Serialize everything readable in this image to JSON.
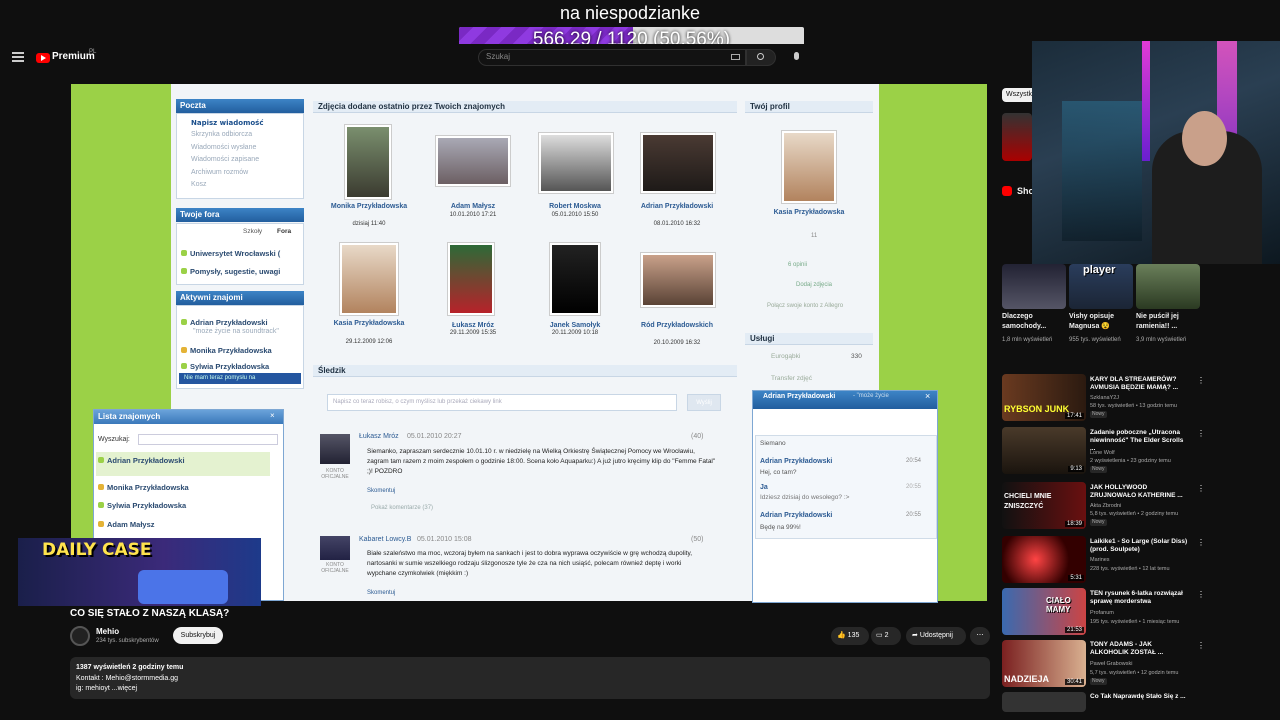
{
  "overlay": {
    "title": "na niespodzianke",
    "goal_text": "566.29 / 1120 (50.56%)",
    "goal_fraction": 0.5056,
    "fill_color": "#7a29c4"
  },
  "header": {
    "brand": "Premium",
    "brand_region": "PL",
    "search_placeholder": "Szukaj"
  },
  "video": {
    "poczta": {
      "title": "Poczta",
      "items": [
        "Napisz wiadomość",
        "Skrzynka odbiorcza",
        "Wiadomości wysłane",
        "Wiadomości zapisane",
        "Archiwum rozmów",
        "Kosz"
      ]
    },
    "fora": {
      "title": "Twoje fora",
      "tab_a": "Szkoły",
      "tab_b": "Fora",
      "items": [
        "Uniwersytet Wrocławski (",
        "Pomysły, sugestie, uwagi"
      ]
    },
    "aktywni": {
      "title": "Aktywni znajomi",
      "items": [
        "Adrian Przykładowski",
        "Monika Przykładowska",
        "Sylwia Przykładowska"
      ],
      "sub": "\"może życie na soundtrack\"",
      "status": "Nie mam teraz pomysłu na"
    },
    "lista": {
      "title": "Lista znajomych",
      "search_label": "Wyszukaj:",
      "items": [
        "Adrian Przykładowski",
        "Monika Przykładowska",
        "Sylwia Przykładowska",
        "Adam Małysz"
      ]
    },
    "zdjecia": {
      "title": "Zdjęcia dodane ostatnio przez Twoich znajomych",
      "photos": [
        {
          "name": "Monika Przykładowska",
          "date": "dzisiaj 11:40"
        },
        {
          "name": "Adam Małysz",
          "date": "10.01.2010 17:21"
        },
        {
          "name": "Robert Moskwa",
          "date": "05.01.2010 15:50"
        },
        {
          "name": "Adrian Przykładowski",
          "date": "08.01.2010 16:32"
        },
        {
          "name": "Kasia Przykładowska",
          "date": "29.12.2009 12:06"
        },
        {
          "name": "Łukasz Mróz",
          "date": "29.11.2009 15:35"
        },
        {
          "name": "Janek Samołyk",
          "date": "20.11.2009 10:18"
        },
        {
          "name": "Ród Przykładowskich",
          "date": "20.10.2009 16:32"
        }
      ]
    },
    "sledzik": {
      "title": "Śledzik",
      "input_placeholder": "Napisz co teraz robisz, o czym myślisz lub przekaż ciekawy link",
      "button": "Wyślij",
      "posts": [
        {
          "author": "Łukasz Mróz",
          "date": "05.01.2010 20:27",
          "count": "(40)",
          "text": "Siemanko, zapraszam serdecznie 10.01.10 r. w niedzielę na Wielką Orkiestrę Świątecznej Pomocy we Wrocławiu, zagram tam razem z moim zespołem o godzinie 18:00. Scena koło Aquaparku:) A już jutro kręcimy klip do \"Femme Fatal\" ;)! POZDRO",
          "comment": "Skomentuj",
          "show": "Pokaż komentarze (37)",
          "tag": "KONTO OFICJALNE"
        },
        {
          "author": "Kabaret Lowcy.B",
          "date": "05.01.2010 15:08",
          "count": "(50)",
          "text": "Białe szaleństwo ma moc, wczoraj byłem na sankach i jest to dobra wyprawa oczywiście w grę wchodzą dupolity, nartosanki w sumie wszelkiego rodzaju ślizgonosze tyle że cza na nich usiąść, polecam również deptę i worki wypchane czymkolwiek (miękkim :)",
          "comment": "Skomentuj",
          "tag": "KONTO OFICJALNE"
        }
      ]
    },
    "profil": {
      "title": "Twój profil",
      "name": "Kasia Przykładowska",
      "ops": "6 opinii",
      "add_photo": "Dodaj zdjęcia",
      "allegro": "Połącz swoje konto z Allegro",
      "count": "11"
    },
    "uslugi": {
      "title": "Usługi",
      "items": [
        {
          "label": "Eurogąbki",
          "value": "330"
        },
        {
          "label": "Transfer zdjęć",
          "value": ""
        }
      ]
    },
    "chat": {
      "title": "Adrian Przykładowski",
      "subtitle": "- \"może życie",
      "messages": [
        {
          "who": "Siemano",
          "time": ""
        },
        {
          "who": "Adrian Przykładowski",
          "time": "20:54",
          "text": "Hej, co tam?"
        },
        {
          "who": "Ja",
          "time": "20:55",
          "text": "Idziesz dzisiaj do wesołego? :>"
        },
        {
          "who": "Adrian Przykładowski",
          "time": "20:55",
          "text": "Będę na 99%!"
        }
      ]
    },
    "daily_case": "DAILY CASE"
  },
  "meta": {
    "title": "CO SIĘ STAŁO Z NASZĄ KLASĄ?",
    "channel": "Mehio",
    "subs": "234 tys. subskrybentów",
    "subscribe": "Subskrybuj",
    "likes": "135",
    "comments": "2",
    "share": "Udostępnij",
    "desc_line1": "1387 wyświetleń  2 godziny temu",
    "desc_line2": "Kontakt : Mehio@stormmedia.gg",
    "desc_line3": "ig: mehioyt  ...więcej"
  },
  "sidebar": {
    "chip": "Wszystkie",
    "shorts_label": "Shorts",
    "shorts": [
      {
        "title": "Dlaczego samochody...",
        "views": "1,8 mln wyświetleń"
      },
      {
        "title": "Vishy opisuje Magnusa 😵",
        "views": "955 tys. wyświetleń",
        "overlay": "player"
      },
      {
        "title": "Nie puścił jej ramienia!! ...",
        "views": "3,9 mln wyświetleń"
      }
    ],
    "videos": [
      {
        "title": "KARY DLA STREAMERÓW? AVMUSIA BĘDZIE MAMĄ? ...",
        "channel": "SzklanaY2J",
        "meta": "58 tys. wyświetleń • 13 godzin temu",
        "badge": "Nowy",
        "duration": "17:41",
        "thumb": "RYBSON JUNK"
      },
      {
        "title": "Zadanie poboczne „Utracona niewinność\" The Elder Scrolls ...",
        "channel": "Lone Wolf",
        "meta": "2 wyświetlenia • 23 godziny temu",
        "badge": "Nowy",
        "duration": "9:13"
      },
      {
        "title": "JAK HOLLYWOOD ZRUJNOWAŁO KATHERINE ...",
        "channel": "Akta Zbrodni",
        "meta": "5,8 tys. wyświetleń • 2 godziny temu",
        "badge": "Nowy",
        "duration": "18:39",
        "thumb": "CHCIELI MNIE ZNISZCZYĆ"
      },
      {
        "title": "Laikike1 - So Large (Solar Diss) (prod. Soulpete)",
        "channel": "Marines",
        "meta": "228 tys. wyświetleń • 12 lat temu",
        "duration": "5:31"
      },
      {
        "title": "TEN rysunek 6-latka rozwiązał sprawę morderstwa",
        "channel": "Profanum",
        "meta": "195 tys. wyświetleń • 1 miesiąc temu",
        "duration": "21:53",
        "thumb": "CIAŁO MAMY"
      },
      {
        "title": "TONY ADAMS - JAK ALKOHOLIK ZOSTAŁ ...",
        "channel": "Paweł Grabowski",
        "meta": "5,7 tys. wyświetleń • 12 godzin temu",
        "badge": "Nowy",
        "duration": "30:41",
        "thumb": "NADZIEJA"
      },
      {
        "title": "Co Tak Naprawdę Stało Się z ..."
      }
    ]
  },
  "colors": {
    "page_bg": "#0f0f0f",
    "video_green": "#9bd147",
    "nk_blue": "#225e9e",
    "yt_red": "#ff0000"
  }
}
